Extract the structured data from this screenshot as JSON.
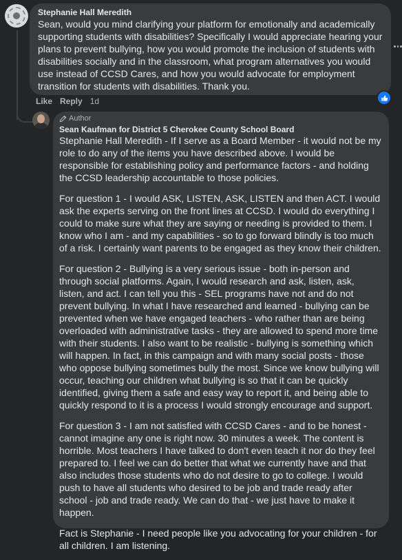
{
  "comment": {
    "author": "Stephanie Hall Meredith",
    "text": "Sean, would you mind clarifying your platform for emotionally and academically supporting students with disabilities? Specifically I would appreciate hearing your plans to prevent bullying, how you would promote the inclusion of students with disabilities socially and in the classroom, what program alternatives you would use instead of CCSD Cares, and how you would advocate for employment transition for students with disabilities. Thank you.",
    "actions": {
      "like": "Like",
      "reply": "Reply",
      "time": "1d"
    },
    "reaction_icon": "thumbs-up-icon"
  },
  "reply": {
    "badge": "Author",
    "author": "Sean Kaufman for District 5 Cherokee County School Board",
    "paragraphs": [
      "Stephanie Hall Meredith - If I serve as a Board Member - it would not be my role to do any of the items you have described above. I would be responsible for establishing policy and performance factors - and holding the CCSD leadership accountable to those policies.",
      "For question 1 - I would ASK, LISTEN, ASK, LISTEN and then ACT. I would ask the experts serving on the front lines at CCSD. I would do everything I could to make sure what they are saying or needing is provided to them. I know who I am - and my capabilities - so to go forward blindly is too much of a risk. I certainly want parents to be engaged as they know their children.",
      "For question 2 - Bullying is a very serious issue - both in-person and through social platforms. Again, I would research and ask, listen, ask, listen, and act. I can tell you this - SEL programs have not and do not prevent bullying. In what I have researched and learned - bullying can be prevented when we have engaged teachers - who rather than are being overloaded with administrative tasks - they are allowed to spend more time with their students. I also want to be realistic - bullying is something which will happen. In fact, in this campaign and with many social posts - those who oppose bullying sometimes bully the most. Since we know bullying will occur, teaching our children what bullying is so that it can be quickly identified, giving them a safe and easy way to report it, and being able to quickly respond to it is a process I would strongly encourage and support.",
      "For question 3 - I am not satisfied with CCSD Cares - and to be honest - cannot imagine any one is right now. 30 minutes a week. The content is horrible. Most teachers I have talked to don't even teach it nor do they feel prepared to. I feel we can do better that what we currently have and that also includes those students who do not desire to go to college. I would push to have all students who desired to be job and trade ready after school - job and trade ready. We can do that - we just have to make it happen.",
      "Fact is Stephanie - I need people like you advocating for your children - for all children. I am listening."
    ]
  },
  "colors": {
    "background": "#242526",
    "bubble": "#3a3b3c",
    "text": "#e4e6eb",
    "muted": "#b0b3b8",
    "accent": "#1877f2"
  }
}
